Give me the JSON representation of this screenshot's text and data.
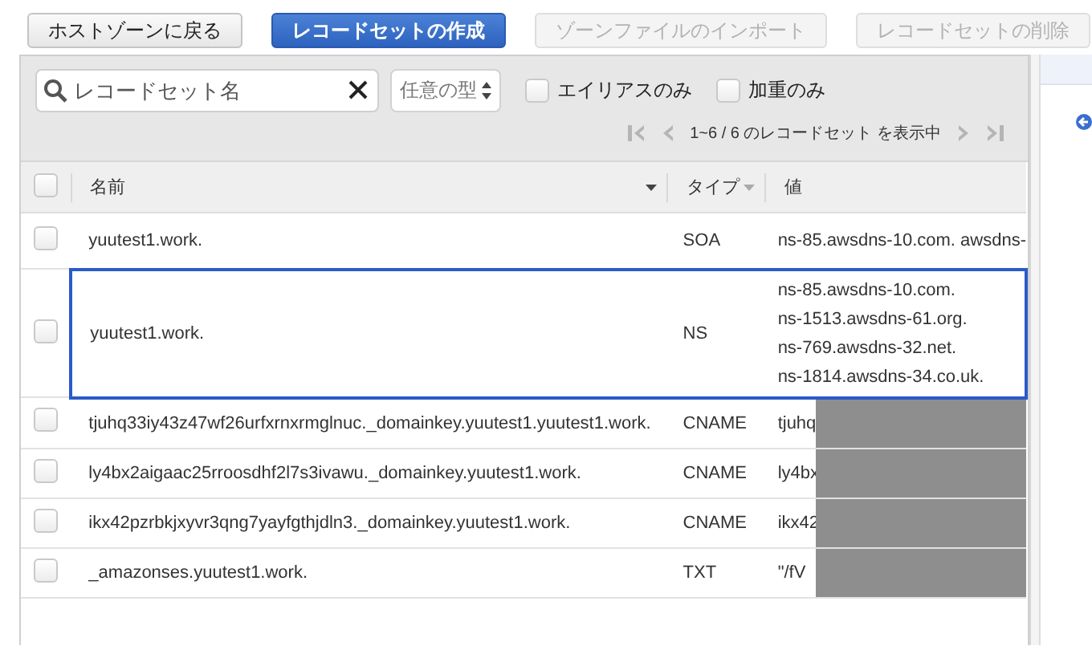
{
  "actions": [
    {
      "label": "ホストゾーンに戻る",
      "kind": "default",
      "disabled": false
    },
    {
      "label": "レコードセットの作成",
      "kind": "primary",
      "disabled": false
    },
    {
      "label": "ゾーンファイルのインポート",
      "kind": "default",
      "disabled": true
    },
    {
      "label": "レコードセットの削除",
      "kind": "default",
      "disabled": true
    }
  ],
  "filter": {
    "search": {
      "placeholder": "レコードセット名"
    },
    "type_select": "任意の型",
    "checkboxes": [
      {
        "label": "エイリアスのみ",
        "checked": false
      },
      {
        "label": "加重のみ",
        "checked": false
      }
    ]
  },
  "pagination": {
    "summary": "1~6 / 6 のレコードセット を表示中"
  },
  "table": {
    "columns": [
      "名前",
      "タイプ",
      "値"
    ],
    "select_all_checked": false,
    "rows": [
      {
        "name": "yuutest1.work.",
        "type": "SOA",
        "values": [
          "ns-85.awsdns-10.com. awsdns-"
        ],
        "checked": false,
        "highlighted": false,
        "redacted": false
      },
      {
        "name": "yuutest1.work.",
        "type": "NS",
        "values": [
          "ns-85.awsdns-10.com.",
          "ns-1513.awsdns-61.org.",
          "ns-769.awsdns-32.net.",
          "ns-1814.awsdns-34.co.uk."
        ],
        "checked": false,
        "highlighted": true,
        "redacted": false
      },
      {
        "name": "tjuhq33iy43z47wf26urfxrnxrmglnuc._domainkey.yuutest1.yuutest1.work.",
        "type": "CNAME",
        "values": [
          "tjuhq"
        ],
        "checked": false,
        "highlighted": false,
        "redacted": true
      },
      {
        "name": "ly4bx2aigaac25rroosdhf2l7s3ivawu._domainkey.yuutest1.work.",
        "type": "CNAME",
        "values": [
          "ly4bx"
        ],
        "checked": false,
        "highlighted": false,
        "redacted": true
      },
      {
        "name": "ikx42pzrbkjxyvr3qng7yayfgthjdln3._domainkey.yuutest1.work.",
        "type": "CNAME",
        "values": [
          "ikx42"
        ],
        "checked": false,
        "highlighted": false,
        "redacted": true
      },
      {
        "name": "_amazonses.yuutest1.work.",
        "type": "TXT",
        "values": [
          "\"/fV"
        ],
        "checked": false,
        "highlighted": false,
        "redacted": true
      }
    ]
  }
}
